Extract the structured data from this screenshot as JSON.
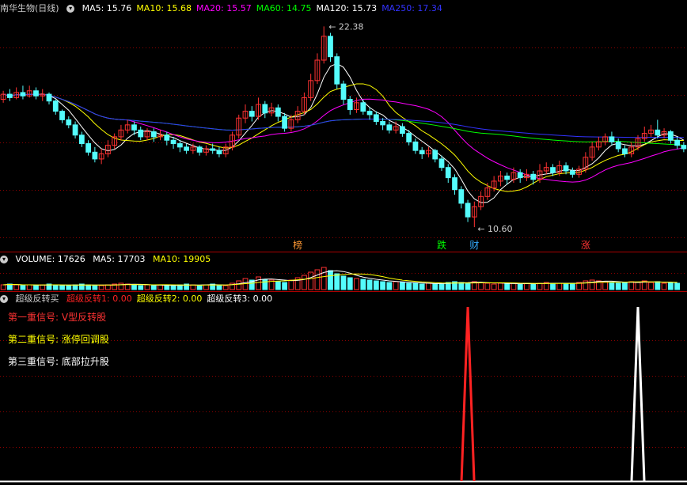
{
  "main_header": {
    "title": "南华生物(日线)",
    "ma": [
      {
        "label": "MA5: 15.76",
        "color": "#ffffff"
      },
      {
        "label": "MA10: 15.68",
        "color": "#ffff00"
      },
      {
        "label": "MA20: 15.57",
        "color": "#ff00ff"
      },
      {
        "label": "MA60: 14.75",
        "color": "#00ff00"
      },
      {
        "label": "MA120: 15.73",
        "color": "#ffffff"
      },
      {
        "label": "MA250: 17.34",
        "color": "#3333ff"
      }
    ]
  },
  "volume_header": {
    "label": "VOLUME: 17626",
    "ma5": "MA5: 17703",
    "ma10": "MA10: 19905",
    "colors": {
      "label": "#ffffff",
      "ma5": "#ffffff",
      "ma10": "#ffff00"
    }
  },
  "indicator_header": {
    "title": "超级反转买",
    "items": [
      {
        "label": "超级反转1: 0.00",
        "color": "#ff2222"
      },
      {
        "label": "超级反转2: 0.00",
        "color": "#ffff00"
      },
      {
        "label": "超级反转3: 0.00",
        "color": "#ffffff"
      }
    ]
  },
  "signals": [
    {
      "label": "第一重信号:",
      "value": "V型反转股",
      "label_color": "#ff3333",
      "value_color": "#ff3333"
    },
    {
      "label": "第二重信号:",
      "value": "涨停回调股",
      "label_color": "#ffff00",
      "value_color": "#ffff00"
    },
    {
      "label": "第三重信号:",
      "value": "底部拉升股",
      "label_color": "#ffffff",
      "value_color": "#ffffff"
    }
  ],
  "price_markers": {
    "high": "22.38",
    "low": "10.60"
  },
  "event_labels": [
    {
      "text": "榜",
      "color": "#ff9933"
    },
    {
      "text": "跌",
      "color": "#00ff00"
    },
    {
      "text": "财",
      "color": "#33aaff"
    },
    {
      "text": "涨",
      "color": "#ff3333"
    }
  ],
  "colors": {
    "up": "#ff3232",
    "down": "#54fcfc",
    "grid": "#8b0000",
    "divider": "#aa0000"
  },
  "chart_data": {
    "type": "candlestick",
    "ylim": [
      10,
      23
    ],
    "high_value": 22.38,
    "low_value": 10.6,
    "ohlc": [
      [
        18.1,
        18.4,
        18.6,
        17.9
      ],
      [
        18.4,
        18.2,
        18.7,
        18.0
      ],
      [
        18.2,
        18.5,
        18.8,
        18.1
      ],
      [
        18.5,
        18.3,
        18.9,
        18.1
      ],
      [
        18.3,
        18.6,
        18.9,
        18.2
      ],
      [
        18.6,
        18.3,
        18.8,
        18.1
      ],
      [
        18.3,
        18.4,
        18.7,
        18.0
      ],
      [
        18.4,
        18.0,
        18.5,
        17.8
      ],
      [
        18.0,
        17.4,
        18.1,
        17.2
      ],
      [
        17.4,
        16.9,
        17.5,
        16.7
      ],
      [
        16.9,
        16.6,
        17.1,
        16.4
      ],
      [
        16.6,
        16.0,
        16.8,
        15.8
      ],
      [
        16.0,
        15.5,
        16.2,
        15.3
      ],
      [
        15.5,
        15.0,
        15.7,
        14.8
      ],
      [
        15.0,
        14.6,
        15.3,
        14.4
      ],
      [
        14.6,
        14.9,
        15.2,
        14.3
      ],
      [
        14.9,
        15.4,
        15.7,
        14.7
      ],
      [
        15.4,
        15.9,
        16.1,
        15.2
      ],
      [
        15.9,
        16.3,
        16.6,
        15.7
      ],
      [
        16.3,
        16.6,
        16.9,
        16.1
      ],
      [
        16.6,
        16.3,
        16.8,
        16.0
      ],
      [
        16.3,
        15.9,
        16.5,
        15.7
      ],
      [
        15.9,
        16.2,
        16.4,
        15.7
      ],
      [
        16.2,
        15.9,
        16.4,
        15.6
      ],
      [
        15.9,
        16.0,
        16.3,
        15.7
      ],
      [
        16.0,
        15.7,
        16.2,
        15.4
      ],
      [
        15.7,
        15.5,
        15.9,
        15.2
      ],
      [
        15.5,
        15.3,
        15.7,
        15.0
      ],
      [
        15.3,
        15.1,
        15.5,
        14.9
      ],
      [
        15.1,
        15.3,
        15.5,
        14.9
      ],
      [
        15.3,
        15.0,
        15.4,
        14.8
      ],
      [
        15.0,
        15.2,
        15.4,
        14.8
      ],
      [
        15.2,
        15.1,
        15.5,
        14.9
      ],
      [
        15.1,
        14.9,
        15.3,
        14.7
      ],
      [
        14.9,
        15.3,
        15.5,
        14.7
      ],
      [
        15.3,
        16.0,
        16.2,
        15.1
      ],
      [
        16.0,
        17.0,
        17.2,
        15.8
      ],
      [
        17.0,
        17.4,
        17.8,
        16.7
      ],
      [
        17.4,
        17.1,
        17.7,
        16.8
      ],
      [
        17.1,
        17.8,
        18.2,
        16.9
      ],
      [
        17.8,
        17.3,
        18.0,
        17.0
      ],
      [
        17.3,
        17.6,
        17.9,
        17.1
      ],
      [
        17.6,
        17.1,
        17.8,
        16.8
      ],
      [
        17.1,
        16.4,
        17.3,
        16.2
      ],
      [
        16.4,
        16.9,
        17.2,
        16.2
      ],
      [
        16.9,
        17.4,
        17.7,
        16.7
      ],
      [
        17.4,
        18.2,
        18.5,
        17.2
      ],
      [
        18.2,
        19.2,
        19.6,
        18.0
      ],
      [
        19.2,
        20.4,
        20.8,
        19.0
      ],
      [
        20.4,
        21.8,
        22.38,
        20.2
      ],
      [
        21.8,
        20.6,
        22.0,
        20.3
      ],
      [
        20.6,
        19.0,
        20.8,
        18.7
      ],
      [
        19.0,
        18.1,
        19.2,
        17.8
      ],
      [
        18.1,
        17.5,
        18.3,
        17.2
      ],
      [
        17.5,
        17.9,
        18.2,
        17.3
      ],
      [
        17.9,
        17.4,
        18.1,
        17.2
      ],
      [
        17.4,
        17.2,
        17.6,
        16.9
      ],
      [
        17.2,
        16.8,
        17.4,
        16.6
      ],
      [
        16.8,
        16.6,
        17.0,
        16.3
      ],
      [
        16.6,
        16.3,
        16.8,
        16.1
      ],
      [
        16.3,
        16.5,
        16.8,
        16.1
      ],
      [
        16.5,
        16.1,
        16.7,
        15.9
      ],
      [
        16.1,
        15.6,
        16.3,
        15.4
      ],
      [
        15.6,
        15.1,
        15.8,
        14.9
      ],
      [
        15.1,
        14.9,
        15.3,
        14.6
      ],
      [
        14.9,
        15.1,
        15.3,
        14.7
      ],
      [
        15.1,
        14.6,
        15.2,
        14.4
      ],
      [
        14.6,
        14.1,
        14.8,
        13.9
      ],
      [
        14.1,
        13.5,
        14.3,
        13.2
      ],
      [
        13.5,
        12.8,
        13.7,
        12.5
      ],
      [
        12.8,
        12.0,
        13.0,
        11.7
      ],
      [
        12.0,
        11.2,
        12.2,
        10.9
      ],
      [
        11.2,
        11.8,
        12.1,
        10.6
      ],
      [
        11.8,
        12.4,
        12.7,
        11.6
      ],
      [
        12.4,
        12.9,
        13.2,
        12.2
      ],
      [
        12.9,
        13.3,
        13.6,
        12.7
      ],
      [
        13.3,
        13.6,
        13.9,
        13.0
      ],
      [
        13.6,
        13.4,
        13.8,
        13.1
      ],
      [
        13.4,
        13.8,
        14.1,
        13.2
      ],
      [
        13.8,
        13.5,
        14.0,
        13.2
      ],
      [
        13.5,
        13.7,
        14.0,
        13.3
      ],
      [
        13.7,
        13.4,
        13.9,
        13.1
      ],
      [
        13.4,
        13.9,
        14.3,
        13.2
      ],
      [
        13.9,
        14.1,
        14.4,
        13.7
      ],
      [
        14.1,
        13.8,
        14.3,
        13.6
      ],
      [
        13.8,
        14.2,
        14.5,
        13.6
      ],
      [
        14.2,
        13.9,
        14.4,
        13.7
      ],
      [
        13.9,
        13.7,
        14.1,
        13.5
      ],
      [
        13.7,
        14.0,
        14.2,
        13.5
      ],
      [
        14.0,
        14.7,
        15.0,
        13.8
      ],
      [
        14.7,
        15.3,
        15.6,
        14.5
      ],
      [
        15.3,
        15.6,
        15.9,
        15.1
      ],
      [
        15.6,
        15.9,
        16.1,
        15.4
      ],
      [
        15.9,
        15.6,
        16.2,
        15.4
      ],
      [
        15.6,
        15.2,
        15.8,
        15.0
      ],
      [
        15.2,
        14.9,
        15.4,
        14.7
      ],
      [
        14.9,
        15.3,
        15.6,
        14.7
      ],
      [
        15.3,
        15.8,
        16.0,
        15.1
      ],
      [
        15.8,
        16.1,
        16.5,
        15.6
      ],
      [
        16.1,
        16.3,
        16.6,
        15.9
      ],
      [
        16.3,
        16.0,
        16.9,
        15.8
      ],
      [
        16.0,
        16.2,
        16.4,
        15.8
      ],
      [
        16.2,
        15.7,
        16.3,
        15.5
      ],
      [
        15.7,
        15.4,
        15.9,
        15.2
      ],
      [
        15.4,
        15.2,
        15.6,
        15.0
      ]
    ],
    "volume": [
      6,
      7,
      6,
      5,
      6,
      5,
      6,
      7,
      6,
      5,
      5,
      6,
      7,
      6,
      5,
      5,
      6,
      7,
      8,
      7,
      6,
      5,
      6,
      5,
      6,
      5,
      5,
      6,
      7,
      6,
      5,
      6,
      7,
      6,
      5,
      8,
      11,
      14,
      12,
      16,
      13,
      12,
      10,
      9,
      12,
      15,
      18,
      22,
      25,
      28,
      24,
      20,
      17,
      15,
      14,
      13,
      12,
      11,
      10,
      9,
      10,
      9,
      8,
      8,
      7,
      8,
      7,
      8,
      9,
      10,
      9,
      8,
      10,
      9,
      8,
      7,
      8,
      7,
      8,
      7,
      8,
      7,
      8,
      9,
      8,
      8,
      7,
      8,
      9,
      11,
      12,
      11,
      10,
      9,
      8,
      9,
      10,
      9,
      11,
      9,
      10,
      8,
      9,
      8
    ],
    "indicator": [
      {
        "series": "超级反转1",
        "index": 71,
        "value": 1,
        "color": "#ff2222"
      },
      {
        "series": "超级反转3",
        "index": 97,
        "value": 1,
        "color": "#ffffff"
      }
    ]
  }
}
